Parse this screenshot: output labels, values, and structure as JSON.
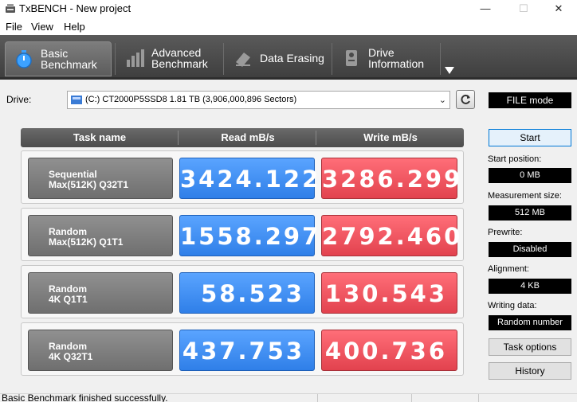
{
  "window": {
    "title": "TxBENCH - New project",
    "minimize_glyph": "—",
    "maximize_glyph": "☐",
    "close_glyph": "✕"
  },
  "menu": [
    "File",
    "View",
    "Help"
  ],
  "tabs": [
    {
      "label": "Basic\nBenchmark",
      "icon": "stopwatch-icon",
      "active": true
    },
    {
      "label": "Advanced\nBenchmark",
      "icon": "bar-chart-icon",
      "active": false
    },
    {
      "label": "Data Erasing",
      "icon": "eraser-icon",
      "active": false
    },
    {
      "label": "Drive\nInformation",
      "icon": "drive-info-icon",
      "active": false
    }
  ],
  "drive": {
    "label": "Drive:",
    "selected": "(C:) CT2000P5SSD8  1.81 TB (3,906,000,896 Sectors)"
  },
  "table": {
    "headers": [
      "Task name",
      "Read mB/s",
      "Write mB/s"
    ],
    "rows": [
      {
        "task_line1": "Sequential",
        "task_line2": "Max(512K) Q32T1",
        "read": "3424.122",
        "write": "3286.299"
      },
      {
        "task_line1": "Random",
        "task_line2": "Max(512K) Q1T1",
        "read": "1558.297",
        "write": "2792.460"
      },
      {
        "task_line1": "Random",
        "task_line2": "4K Q1T1",
        "read": "58.523",
        "write": "130.543"
      },
      {
        "task_line1": "Random",
        "task_line2": "4K Q32T1",
        "read": "437.753",
        "write": "400.736"
      }
    ]
  },
  "side": {
    "mode": "FILE mode",
    "start_label": "Start",
    "start_position_label": "Start position:",
    "start_position": "0 MB",
    "measurement_size_label": "Measurement size:",
    "measurement_size": "512 MB",
    "prewrite_label": "Prewrite:",
    "prewrite": "Disabled",
    "alignment_label": "Alignment:",
    "alignment": "4 KB",
    "writing_data_label": "Writing data:",
    "writing_data": "Random number",
    "task_options_label": "Task options",
    "history_label": "History"
  },
  "status": {
    "message": "Basic Benchmark finished successfully."
  },
  "colors": {
    "read": "#2f7fe8",
    "write": "#e2424e",
    "toolbar": "#4c4c4c"
  }
}
